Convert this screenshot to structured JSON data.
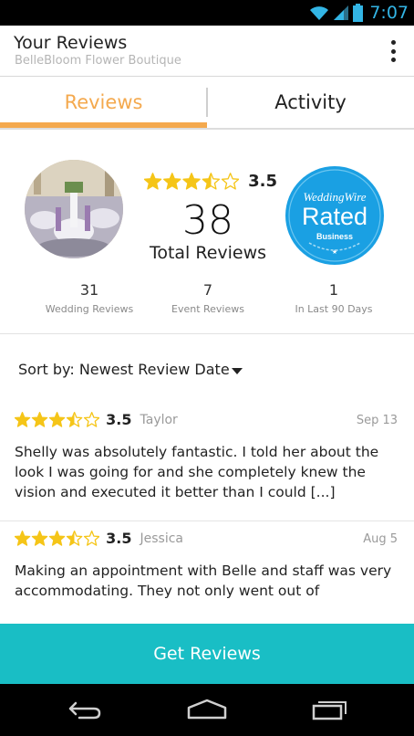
{
  "status_bar": {
    "time": "7:07",
    "accent": "#33b5e5"
  },
  "app_bar": {
    "title": "Your Reviews",
    "subtitle": "BelleBloom Flower  Boutique",
    "menu_icon": "overflow-menu-icon"
  },
  "tabs": [
    {
      "label": "Reviews",
      "active": true
    },
    {
      "label": "Activity",
      "active": false
    }
  ],
  "colors": {
    "accent": "#f4a94e",
    "star": "#f5c518",
    "cta": "#19bec5",
    "badge": "#1aa0e3"
  },
  "summary": {
    "rating": "3.5",
    "stars": 3.5,
    "total_count": "38",
    "total_label": "Total Reviews",
    "badge": {
      "line1": "WeddingWire",
      "line2": "Rated",
      "line3": "Business"
    },
    "stats": [
      {
        "value": "31",
        "label": "Wedding Reviews"
      },
      {
        "value": "7",
        "label": "Event Reviews"
      },
      {
        "value": "1",
        "label": "In Last 90 Days"
      }
    ]
  },
  "sort": {
    "label": "Sort by: Newest Review Date"
  },
  "reviews": [
    {
      "rating": "3.5",
      "stars": 3.5,
      "author": "Taylor",
      "date": "Sep 13",
      "text": "Shelly was absolutely fantastic. I told her about the look I was going for and she completely knew the vision and executed it better than I could [...]"
    },
    {
      "rating": "3.5",
      "stars": 3.5,
      "author": "Jessica",
      "date": "Aug 5",
      "text": "Making an appointment with Belle and staff was very accommodating. They not only went out of"
    }
  ],
  "cta": {
    "label": "Get Reviews"
  }
}
